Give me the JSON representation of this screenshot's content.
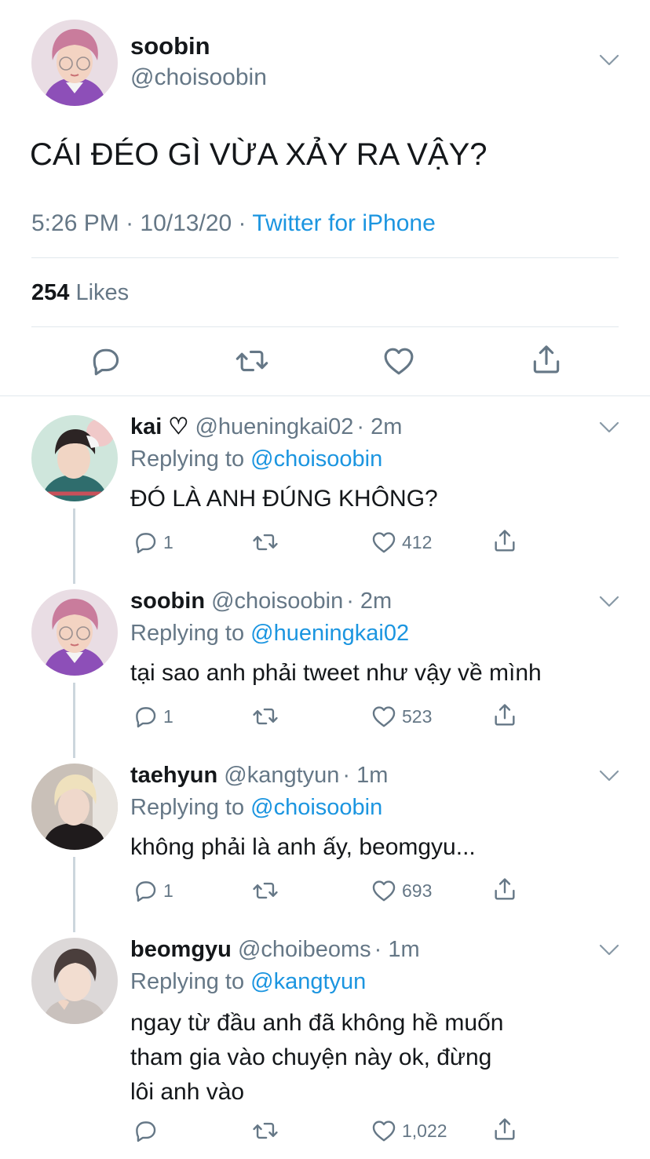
{
  "main_tweet": {
    "display_name": "soobin",
    "handle": "@choisoobin",
    "text": "CÁI ĐÉO GÌ VỪA XẢY RA VẬY?",
    "time": "5:26 PM",
    "sep1": " · ",
    "date": "10/13/20",
    "sep2": " · ",
    "source": "Twitter for iPhone",
    "likes_count": "254",
    "likes_label": " Likes",
    "avatar_icon": "avatar-photo"
  },
  "replies": [
    {
      "display_name": "kai ♡",
      "handle": "@hueningkai02",
      "time": "· 2m",
      "replying_label": "Replying to ",
      "replying_to": "@choisoobin",
      "text_lines": [
        "ĐÓ LÀ ANH ĐÚNG KHÔNG?"
      ],
      "reply_count": "1",
      "like_count": "412"
    },
    {
      "display_name": "soobin",
      "handle": "@choisoobin",
      "time": "· 2m",
      "replying_label": "Replying to ",
      "replying_to": "@hueningkai02",
      "text_lines": [
        "tại sao anh phải tweet như vậy về mình"
      ],
      "reply_count": "1",
      "like_count": "523"
    },
    {
      "display_name": "taehyun",
      "handle": "@kangtyun",
      "time": "· 1m",
      "replying_label": "Replying to ",
      "replying_to": "@choisoobin",
      "text_lines": [
        "không phải là anh ấy, beomgyu..."
      ],
      "reply_count": "1",
      "like_count": "693"
    },
    {
      "display_name": "beomgyu",
      "handle": "@choibeoms",
      "time": "· 1m",
      "replying_label": "Replying to ",
      "replying_to": "@kangtyun",
      "text_lines": [
        "ngay từ đầu anh đã không hề muốn",
        "tham gia vào chuyện này ok, đừng",
        "lôi anh vào"
      ],
      "reply_count": "",
      "like_count": "1,022"
    }
  ],
  "colors": {
    "link": "#1b95e0",
    "muted": "#657786",
    "divider": "#e1e8ed",
    "thread_line": "#ccd6dd"
  },
  "icons": [
    "reply-icon",
    "retweet-icon",
    "like-icon",
    "share-icon",
    "chevron-down-icon"
  ]
}
